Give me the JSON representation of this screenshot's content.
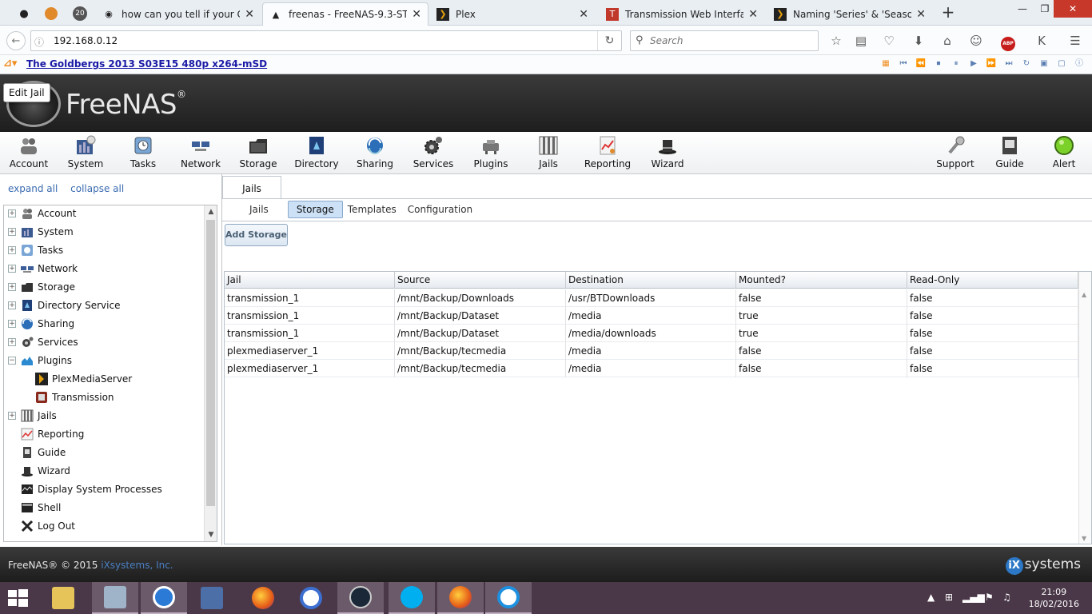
{
  "browser": {
    "tabs": [
      {
        "title": "how can you tell if your C...",
        "active": false
      },
      {
        "title": "freenas - FreeNAS-9.3-ST...",
        "active": true
      },
      {
        "title": "Plex",
        "active": false
      },
      {
        "title": "Transmission Web Interface",
        "active": false
      },
      {
        "title": "Naming 'Series' & 'Season...",
        "active": false
      }
    ],
    "pinned_badge": "20",
    "url": "192.168.0.12",
    "search_placeholder": "Search",
    "abp_badge": "ABP",
    "bookmark_link": "The Goldbergs 2013 S03E15 480p x264-mSD"
  },
  "freenas": {
    "logo": "FreeNAS",
    "tooltip": "Edit Jail",
    "toolbar": {
      "left": [
        "Account",
        "System",
        "Tasks",
        "Network",
        "Storage",
        "Directory",
        "Sharing",
        "Services",
        "Plugins",
        "Jails",
        "Reporting",
        "Wizard"
      ],
      "right": [
        "Support",
        "Guide",
        "Alert"
      ]
    },
    "tree_controls": {
      "expand": "expand all",
      "collapse": "collapse all"
    },
    "tree": [
      {
        "label": "Account",
        "expander": "+",
        "indent": 0
      },
      {
        "label": "System",
        "expander": "+",
        "indent": 0
      },
      {
        "label": "Tasks",
        "expander": "+",
        "indent": 0
      },
      {
        "label": "Network",
        "expander": "+",
        "indent": 0
      },
      {
        "label": "Storage",
        "expander": "+",
        "indent": 0
      },
      {
        "label": "Directory Service",
        "expander": "+",
        "indent": 0
      },
      {
        "label": "Sharing",
        "expander": "+",
        "indent": 0
      },
      {
        "label": "Services",
        "expander": "+",
        "indent": 0
      },
      {
        "label": "Plugins",
        "expander": "−",
        "indent": 0
      },
      {
        "label": "PlexMediaServer",
        "expander": "",
        "indent": 1
      },
      {
        "label": "Transmission",
        "expander": "",
        "indent": 1
      },
      {
        "label": "Jails",
        "expander": "+",
        "indent": 0
      },
      {
        "label": "Reporting",
        "expander": "",
        "indent": 0
      },
      {
        "label": "Guide",
        "expander": "",
        "indent": 0
      },
      {
        "label": "Wizard",
        "expander": "",
        "indent": 0
      },
      {
        "label": "Display System Processes",
        "expander": "",
        "indent": 0
      },
      {
        "label": "Shell",
        "expander": "",
        "indent": 0
      },
      {
        "label": "Log Out",
        "expander": "",
        "indent": 0
      }
    ],
    "main": {
      "top_tab": "Jails",
      "subtabs": [
        "Jails",
        "Storage",
        "Templates",
        "Configuration"
      ],
      "selected_subtab": "Storage",
      "add_button": "Add Storage",
      "columns": [
        "Jail",
        "Source",
        "Destination",
        "Mounted?",
        "Read-Only"
      ],
      "rows": [
        [
          "transmission_1",
          "/mnt/Backup/Downloads",
          "/usr/BTDownloads",
          "false",
          "false"
        ],
        [
          "transmission_1",
          "/mnt/Backup/Dataset",
          "/media",
          "true",
          "false"
        ],
        [
          "transmission_1",
          "/mnt/Backup/Dataset",
          "/media/downloads",
          "true",
          "false"
        ],
        [
          "plexmediaserver_1",
          "/mnt/Backup/tecmedia",
          "/media",
          "false",
          "false"
        ],
        [
          "plexmediaserver_1",
          "/mnt/Backup/tecmedia",
          "/media",
          "false",
          "false"
        ]
      ]
    },
    "footer": {
      "copyright": "FreeNAS® © 2015 ",
      "company": "iXsystems, Inc.",
      "brand": "systems",
      "brand_badge": "iX"
    }
  },
  "taskbar": {
    "time": "21:09",
    "date": "18/02/2016"
  },
  "colors": {
    "header_dark": "#2a2a2a",
    "link_blue": "#3a6bb0",
    "selected_tab": "#cde1f6",
    "taskbar": "#4a3849"
  }
}
